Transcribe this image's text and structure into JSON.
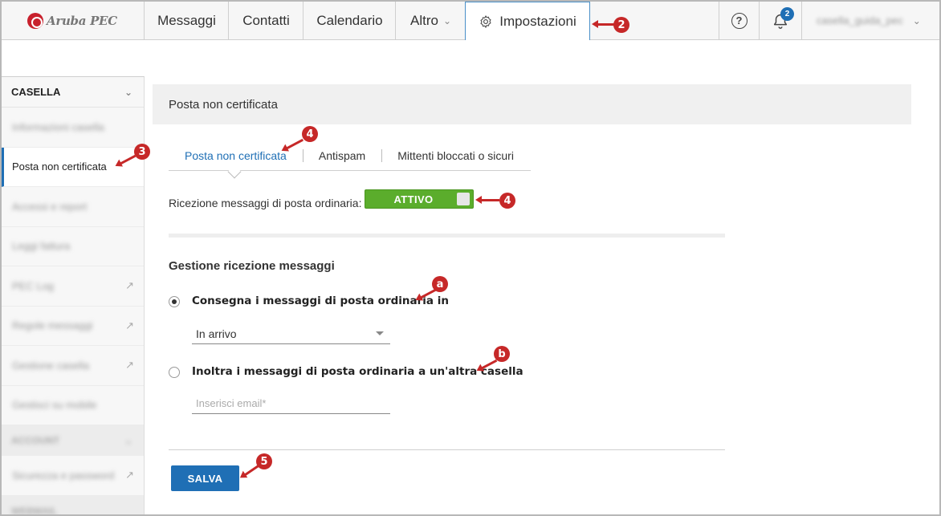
{
  "topbar": {
    "logo_text": "Aruba PEC",
    "tabs": [
      {
        "label": "Messaggi"
      },
      {
        "label": "Contatti"
      },
      {
        "label": "Calendario"
      },
      {
        "label": "Altro"
      },
      {
        "label": "Impostazioni"
      }
    ],
    "notification_count": "2",
    "user_name": "casella_guida_pec"
  },
  "sidebar": {
    "section_title": "CASELLA",
    "items": [
      {
        "label": "Informazioni casella"
      },
      {
        "label": "Posta non certificata"
      },
      {
        "label": "Accessi e report"
      },
      {
        "label": "Leggi fattura"
      },
      {
        "label": "PEC Log"
      },
      {
        "label": "Regole messaggi"
      },
      {
        "label": "Gestione casella"
      },
      {
        "label": "Gestisci su mobile"
      }
    ],
    "section2_title": "ACCOUNT",
    "section2_items": [
      {
        "label": "Sicurezza e password"
      }
    ],
    "section3_title": "WEBMAIL"
  },
  "main": {
    "header_title": "Posta non certificata",
    "subtabs": [
      {
        "label": "Posta non certificata"
      },
      {
        "label": "Antispam"
      },
      {
        "label": "Mittenti bloccati o sicuri"
      }
    ],
    "ricezione_label": "Ricezione messaggi di posta ordinaria:",
    "toggle_label": "ATTIVO",
    "toggle_on": true,
    "section_title": "Gestione ricezione messaggi",
    "option1_label": "Consegna i messaggi di posta ordinaria in",
    "option1_selected": true,
    "select_value": "In arrivo",
    "option2_label": "Inoltra i messaggi di posta ordinaria a un'altra casella",
    "email_placeholder": "Inserisci email*",
    "save_label": "SALVA"
  },
  "annotations": {
    "marker_2": "2",
    "marker_3": "3",
    "marker_4a": "4",
    "marker_4b": "4",
    "marker_a": "a",
    "marker_b": "b",
    "marker_5": "5"
  },
  "colors": {
    "accent": "#1f6fb5",
    "toggle_on": "#5bad2c",
    "annotation": "#c62828",
    "brand": "#c8202c"
  }
}
